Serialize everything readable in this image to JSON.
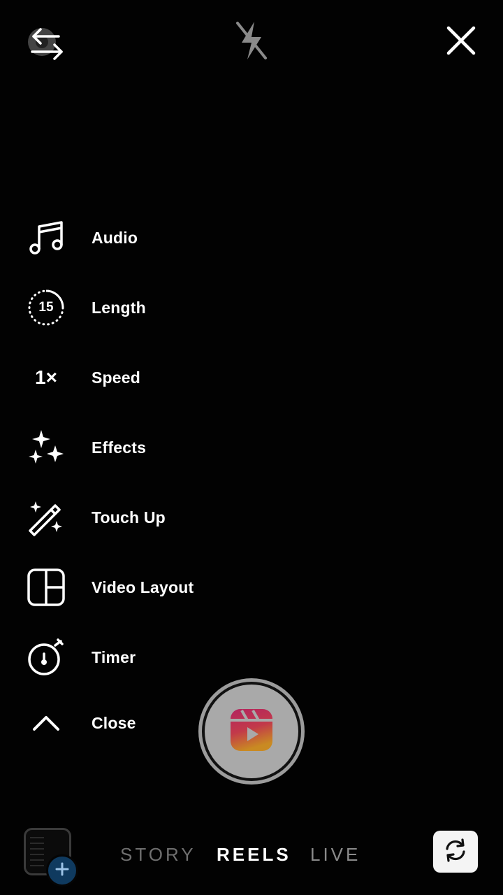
{
  "top_bar": {
    "settings_icon": "gear-swap-icon",
    "flash_icon": "flash-off-icon",
    "close_icon": "close-icon"
  },
  "menu": {
    "items": [
      {
        "label": "Audio",
        "icon": "music-note-icon"
      },
      {
        "label": "Length",
        "icon": "timer-15-icon",
        "icon_text": "15"
      },
      {
        "label": "Speed",
        "icon": "speed-icon",
        "icon_text": "1×"
      },
      {
        "label": "Effects",
        "icon": "sparkles-icon"
      },
      {
        "label": "Touch Up",
        "icon": "magic-wand-icon"
      },
      {
        "label": "Video Layout",
        "icon": "layout-grid-icon"
      },
      {
        "label": "Timer",
        "icon": "stopwatch-icon"
      },
      {
        "label": "Close",
        "icon": "chevron-up-icon"
      }
    ]
  },
  "shutter": {
    "icon": "reels-icon"
  },
  "modes": {
    "items": [
      "STORY",
      "REELS",
      "LIVE"
    ],
    "active": "REELS"
  },
  "bottom": {
    "gallery_icon": "gallery-thumbnail",
    "add_icon": "plus-icon",
    "flip_icon": "camera-flip-icon"
  },
  "colors": {
    "background": "#000000",
    "text": "#ffffff",
    "mode_inactive": "#8a8a8a",
    "reels_gradient_start": "#d6249f",
    "reels_gradient_end": "#fd9c2f"
  }
}
